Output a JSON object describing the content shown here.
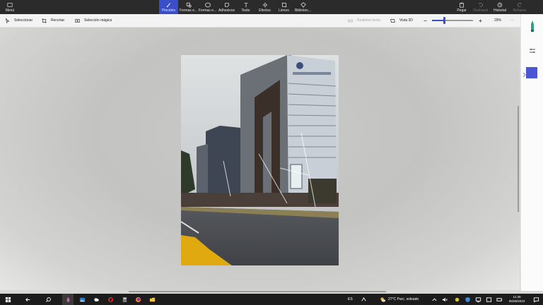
{
  "topbar": {
    "menu_label": "Menú",
    "tabs": [
      {
        "label": "Pinceles",
        "icon": "brush-icon"
      },
      {
        "label": "Formas e...",
        "icon": "shapes-2d-icon"
      },
      {
        "label": "Formas e...",
        "icon": "shapes-3d-icon"
      },
      {
        "label": "Adhesivos",
        "icon": "sticker-icon"
      },
      {
        "label": "Texto",
        "icon": "text-icon"
      },
      {
        "label": "Efectos",
        "icon": "effects-icon"
      },
      {
        "label": "Lienzo",
        "icon": "canvas-icon"
      },
      {
        "label": "Bibliotec...",
        "icon": "library-icon"
      }
    ],
    "right": [
      {
        "label": "Pegar",
        "icon": "paste-icon"
      },
      {
        "label": "Deshacer",
        "icon": "undo-icon"
      },
      {
        "label": "Historial",
        "icon": "history-icon"
      },
      {
        "label": "Rehacer",
        "icon": "redo-icon"
      }
    ],
    "accent": "#3a4fc7"
  },
  "subbar": {
    "select_label": "Seleccionar",
    "crop_label": "Recortar",
    "magic_label": "Selección mágica",
    "mixed_reality_label": "Realidad mixta",
    "view3d_label": "Vista 3D",
    "zoom_percent": "29%",
    "zoom_level": 0.29,
    "more_label": "···"
  },
  "right_panel": {
    "selected_color": "#4a56d6"
  },
  "taskbar": {
    "weather_text": "27°C  Parc. soleado",
    "time": "11:30",
    "date": "06/05/2023",
    "lang": "ES"
  }
}
